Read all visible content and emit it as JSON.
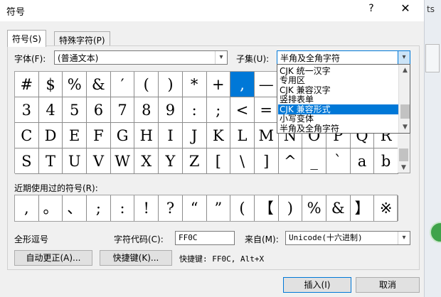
{
  "window": {
    "title": "符号",
    "help_label": "?",
    "close_label": "✕",
    "behind_text": "ts"
  },
  "tabs": [
    {
      "label": "符号(S)",
      "active": true
    },
    {
      "label": "特殊字符(P)",
      "active": false
    }
  ],
  "font": {
    "label": "字体(F):",
    "value": "(普通文本)"
  },
  "subset": {
    "label": "子集(U):",
    "value": "半角及全角字符",
    "options": [
      "CJK 统一汉字",
      "专用区",
      "CJK 兼容汉字",
      "竖排表单",
      "CJK 兼容形式",
      "小写变体",
      "半角及全角字符"
    ],
    "highlighted_index": 4
  },
  "symbol_grid": {
    "rows": [
      [
        "#",
        "$",
        "%",
        "&",
        "′",
        "(",
        ")",
        "*",
        "+",
        ",",
        "—",
        "",
        "",
        "",
        "",
        ""
      ],
      [
        "3",
        "4",
        "5",
        "6",
        "7",
        "8",
        "9",
        ":",
        ";",
        "<",
        "=",
        "",
        "",
        "",
        "",
        ""
      ],
      [
        "C",
        "D",
        "E",
        "F",
        "G",
        "H",
        "I",
        "J",
        "K",
        "L",
        "M",
        "N",
        "O",
        "P",
        "Q",
        "R"
      ],
      [
        "S",
        "T",
        "U",
        "V",
        "W",
        "X",
        "Y",
        "Z",
        "[",
        "\\",
        "]",
        "^",
        "_",
        "`",
        "a",
        "b"
      ]
    ],
    "selected": {
      "row": 0,
      "col": 9
    }
  },
  "recent": {
    "label": "近期使用过的符号(R):",
    "symbols": [
      ",",
      "。",
      "、",
      ";",
      ":",
      "!",
      "?",
      "“",
      "”",
      "(",
      "【",
      ")",
      "%",
      "&",
      "】",
      "※"
    ]
  },
  "info": {
    "char_name": "全形逗号",
    "code_label": "字符代码(C):",
    "code_value": "FF0C",
    "from_label": "来自(M):",
    "from_value": "Unicode(十六进制)",
    "shortcut_text": "快捷键: FF0C, Alt+X"
  },
  "buttons": {
    "autocorrect": "自动更正(A)...",
    "shortcut_key": "快捷键(K)...",
    "insert": "插入(I)",
    "cancel": "取消"
  },
  "colors": {
    "accent": "#0078d7",
    "dialog_bg": "#f0f0f0"
  }
}
